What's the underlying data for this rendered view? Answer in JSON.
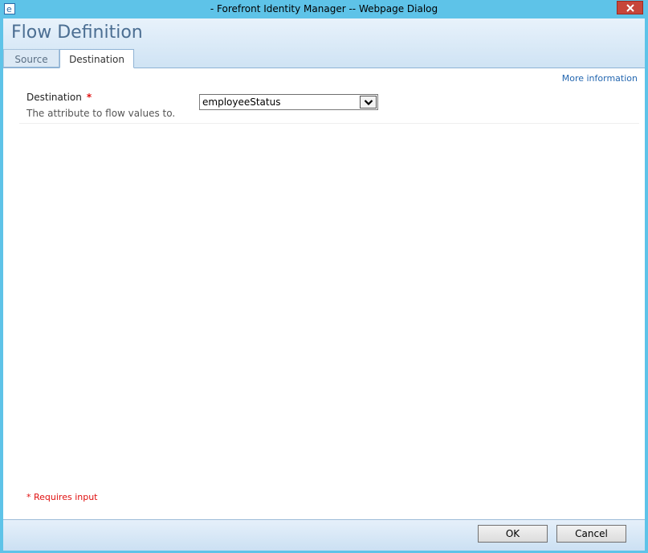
{
  "window": {
    "title": "- Forefront Identity Manager -- Webpage Dialog"
  },
  "header": {
    "page_title": "Flow Definition",
    "tabs": [
      {
        "label": "Source",
        "active": false
      },
      {
        "label": "Destination",
        "active": true
      }
    ]
  },
  "content": {
    "more_info": "More information",
    "destination": {
      "label": "Destination",
      "required_marker": "*",
      "description": "The attribute to flow values to.",
      "selected_value": "employeeStatus"
    },
    "requires_input": "* Requires input"
  },
  "footer": {
    "ok_label": "OK",
    "cancel_label": "Cancel"
  },
  "colors": {
    "titlebar": "#5ec3e8",
    "title_text": "#4b6e92",
    "required": "#e01010",
    "link": "#2467b0"
  }
}
